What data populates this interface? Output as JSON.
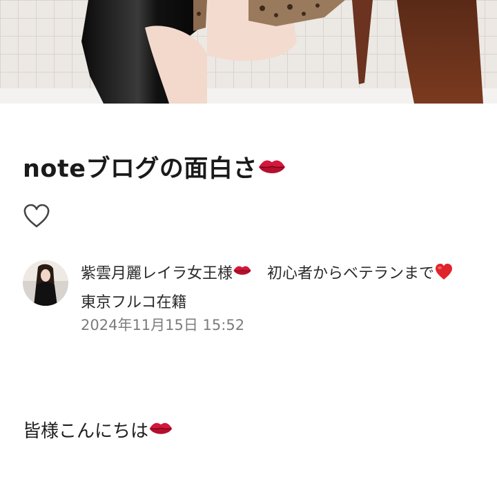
{
  "article": {
    "title": "noteブログの面白さ",
    "title_emoji": "kiss-mark-icon"
  },
  "like": {
    "icon": "heart-outline-icon"
  },
  "author": {
    "name_part1": "紫雲月麗レイラ女王様",
    "name_part2": "　初心者からベテランまで",
    "name_part3": "　東京フルコ在籍",
    "published_at": "2024年11月15日 15:52"
  },
  "body": {
    "greeting": "皆様こんにちは"
  },
  "colors": {
    "heart_red": "#e0242b",
    "lips_red": "#d4173a",
    "text": "#1f1f1f",
    "muted": "#7c7c7c"
  }
}
